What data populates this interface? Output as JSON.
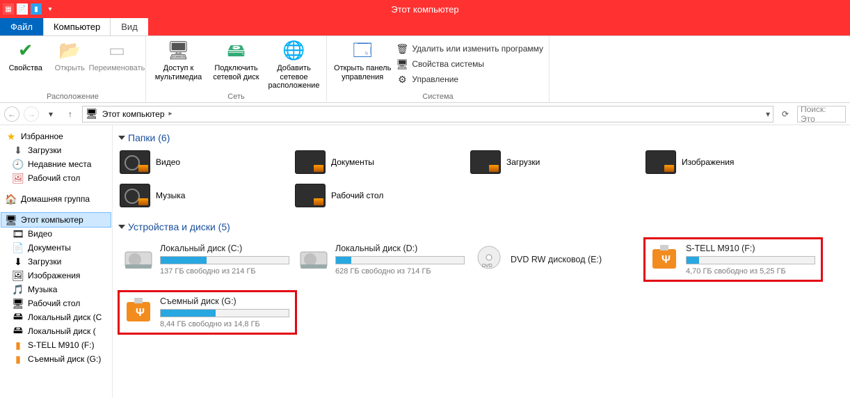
{
  "window": {
    "title": "Этот компьютер"
  },
  "tabs": {
    "file": "Файл",
    "t1": "Компьютер",
    "t2": "Вид"
  },
  "ribbon": {
    "location": {
      "label": "Расположение",
      "properties": "Свойства",
      "open": "Открыть",
      "rename": "Переименовать"
    },
    "network": {
      "label": "Сеть",
      "media": "Доступ к мультимедиа",
      "map": "Подключить сетевой диск",
      "addnet": "Добавить сетевое расположение"
    },
    "system": {
      "label": "Система",
      "cpanel": "Открыть панель управления",
      "uninstall": "Удалить или изменить программу",
      "sysprops": "Свойства системы",
      "manage": "Управление"
    }
  },
  "nav": {
    "breadcrumb": "Этот компьютер",
    "search_placeholder": "Поиск: Это"
  },
  "sidebar": {
    "fav": "Избранное",
    "downloads": "Загрузки",
    "recent": "Недавние места",
    "desktop": "Рабочий стол",
    "homegroup": "Домашняя группа",
    "thispc": "Этот компьютер",
    "video": "Видео",
    "documents": "Документы",
    "downloads2": "Загрузки",
    "pictures": "Изображения",
    "music": "Музыка",
    "desktop2": "Рабочий стол",
    "ldc": "Локальный диск (C",
    "ldd": "Локальный диск (",
    "stell": "S-TELL M910 (F:)",
    "remg": "Съемный диск (G:)"
  },
  "sections": {
    "folders": "Папки (6)",
    "drives": "Устройства и диски (5)"
  },
  "folders": {
    "video": "Видео",
    "documents": "Документы",
    "downloads": "Загрузки",
    "pictures": "Изображения",
    "music": "Музыка",
    "desktop": "Рабочий стол"
  },
  "drives": {
    "c": {
      "name": "Локальный диск (C:)",
      "sub": "137 ГБ свободно из 214 ГБ",
      "fill": 36
    },
    "d": {
      "name": "Локальный диск (D:)",
      "sub": "628 ГБ свободно из 714 ГБ",
      "fill": 12
    },
    "dvd": {
      "name": "DVD RW дисковод (E:)"
    },
    "f": {
      "name": "S-TELL M910 (F:)",
      "sub": "4,70 ГБ свободно из 5,25 ГБ",
      "fill": 10
    },
    "g": {
      "name": "Съемный диск (G:)",
      "sub": "8,44 ГБ свободно из 14,8 ГБ",
      "fill": 43
    }
  }
}
